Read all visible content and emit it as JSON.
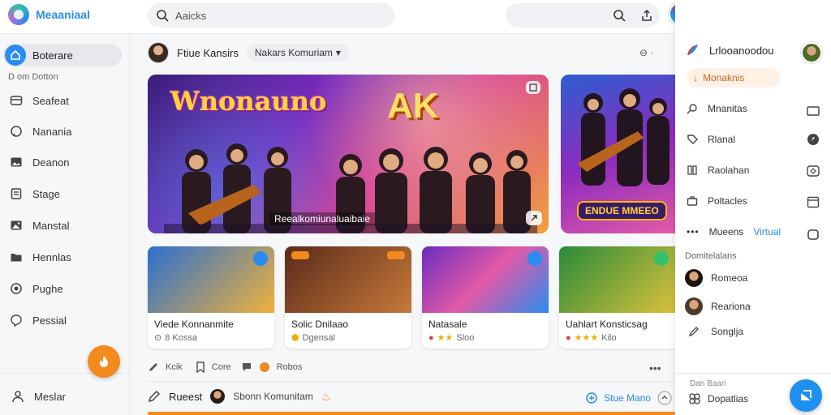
{
  "brand": {
    "name": "Meaaniaal"
  },
  "search": {
    "value": "Aaicks"
  },
  "sidebar": {
    "active_label": "Boterare",
    "sub_label": "D om Dotton",
    "items": [
      {
        "label": "Seafeat",
        "icon": "card-icon"
      },
      {
        "label": "Nanania",
        "icon": "chat-icon"
      },
      {
        "label": "Deanon",
        "icon": "image-icon"
      },
      {
        "label": "Stage",
        "icon": "document-icon"
      },
      {
        "label": "Manstal",
        "icon": "gallery-icon"
      },
      {
        "label": "Hennlas",
        "icon": "folder-icon"
      },
      {
        "label": "Pughe",
        "icon": "badge-icon"
      },
      {
        "label": "Pessial",
        "icon": "message-icon"
      }
    ],
    "profile_label": "Meslar"
  },
  "main": {
    "title": "Ftiue Kansirs",
    "filter_pill": "Nakars Komuriam",
    "more_label": "⊖ ·",
    "hero": {
      "title": "Wnonauno",
      "big_text": "AK",
      "caption": "Reealkomiunaluaibaie"
    },
    "side_hero": {
      "label": "ENDUE MMEEO"
    },
    "cards": [
      {
        "title": "Viede Konnanmite",
        "meta": "8 Kossa"
      },
      {
        "title": "Solic Dnilaao",
        "meta": "Dgensal"
      },
      {
        "title": "Natasale",
        "meta": "Sloo"
      },
      {
        "title": "Uahlart Konsticsag",
        "meta": "Kilo"
      }
    ],
    "actions": [
      {
        "label": "Kcik"
      },
      {
        "label": "Core"
      },
      {
        "label": "Robos"
      }
    ],
    "compose": {
      "label": "Rueest",
      "sub_label": "Sbonn Komunitam",
      "right_label": "Stue Mano"
    }
  },
  "right_panel": {
    "title": "Lrlooanoodou",
    "chip": "Monaknis",
    "items": [
      {
        "label": "Mnanitas"
      },
      {
        "label": "Rlanal"
      },
      {
        "label": "Raolahan"
      },
      {
        "label": "Poltacles"
      },
      {
        "label": "Mueens",
        "extra": "Virtual"
      }
    ],
    "section_title": "Domitelalans",
    "people": [
      {
        "label": "Romeoa"
      },
      {
        "label": "Reariona"
      },
      {
        "label": "Songlja"
      }
    ],
    "bottom_sub": "Dan Baari",
    "bottom_label": "Dopatlias"
  },
  "colors": {
    "accent": "#2a8cf0",
    "orange": "#f28a1e",
    "notification": "#e23b3b"
  }
}
